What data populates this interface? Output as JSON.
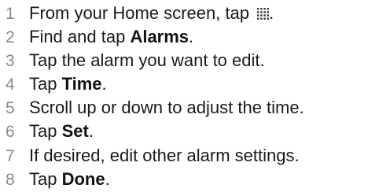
{
  "steps": [
    {
      "number": "1",
      "before": "From your Home screen, tap ",
      "bold": "",
      "after": ".",
      "icon": "apps-grid-icon"
    },
    {
      "number": "2",
      "before": "Find and tap ",
      "bold": "Alarms",
      "after": "."
    },
    {
      "number": "3",
      "before": "Tap the alarm you want to edit.",
      "bold": "",
      "after": ""
    },
    {
      "number": "4",
      "before": "Tap ",
      "bold": "Time",
      "after": "."
    },
    {
      "number": "5",
      "before": "Scroll up or down to adjust the time.",
      "bold": "",
      "after": ""
    },
    {
      "number": "6",
      "before": "Tap ",
      "bold": "Set",
      "after": "."
    },
    {
      "number": "7",
      "before": "If desired, edit other alarm settings.",
      "bold": "",
      "after": ""
    },
    {
      "number": "8",
      "before": "Tap ",
      "bold": "Done",
      "after": "."
    }
  ]
}
